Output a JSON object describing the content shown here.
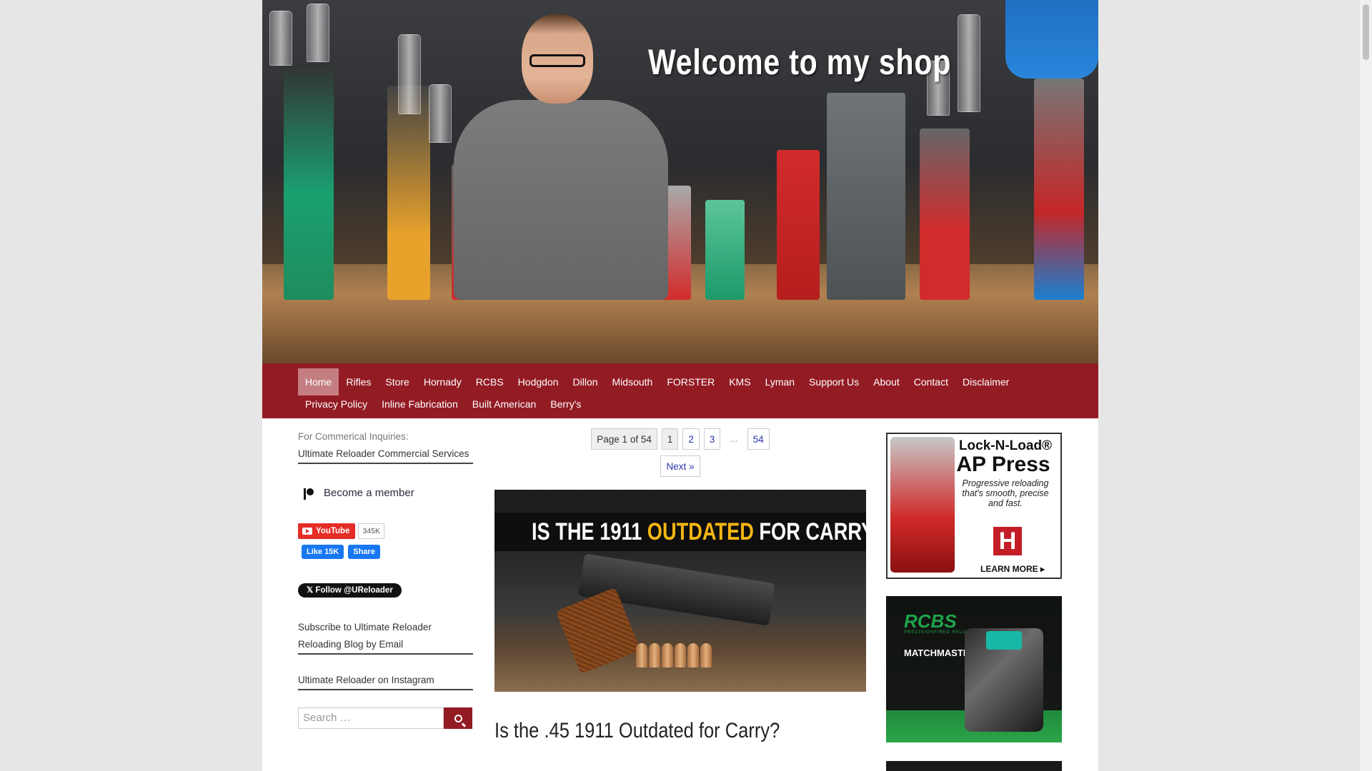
{
  "header": {
    "banner_title": "Welcome to my shop"
  },
  "nav": {
    "row1": [
      "Home",
      "Rifles",
      "Store",
      "Hornady",
      "RCBS",
      "Hodgdon",
      "Dillon",
      "Midsouth",
      "FORSTER",
      "KMS",
      "Lyman",
      "Support Us",
      "About",
      "Contact",
      "Disclaimer"
    ],
    "row2": [
      "Privacy Policy",
      "Inline Fabrication",
      "Built American",
      "Berry's"
    ],
    "active": "Home"
  },
  "sidebar": {
    "commercial_label": "For Commerical Inquiries:",
    "commercial_link": "Ultimate Reloader Commercial Services",
    "member_label": "Become a member",
    "youtube_label": "YouTube",
    "youtube_count": "345K",
    "fb_like_label": "Like 15K",
    "fb_share_label": "Share",
    "twitter_label": "Follow @UReloader",
    "subscribe_label": "Subscribe to Ultimate Reloader Reloading Blog by Email",
    "instagram_label": "Ultimate Reloader on Instagram",
    "search_placeholder": "Search …"
  },
  "pagination": {
    "info": "Page 1 of 54",
    "pages": [
      "1",
      "2",
      "3"
    ],
    "ellipsis": "...",
    "last": "54",
    "next": "Next »"
  },
  "post": {
    "image_title_pre": "IS THE 1911 ",
    "image_title_highlight": "OUTDATED",
    "image_title_post": " FOR CARRY?",
    "title": "Is the .45 1911 Outdated for Carry?"
  },
  "ads": {
    "ad1_line1": "Lock-N-Load®",
    "ad1_line2": "AP Press",
    "ad1_tagline": "Progressive reloading that's smooth, precise and fast.",
    "ad1_logo": "H",
    "ad1_cta": "LEARN MORE ▸",
    "ad2_brand": "RCBS",
    "ad2_sub": "PRECISIONFIRED RELOADING",
    "ad2_product": "MATCHMASTER®"
  },
  "colors": {
    "nav_bg": "#931b24",
    "nav_active": "#c47e82",
    "accent_yellow": "#f5b614"
  }
}
